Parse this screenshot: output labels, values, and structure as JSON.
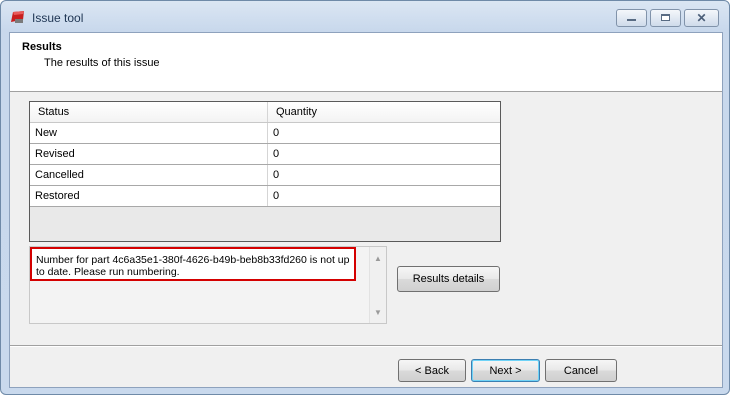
{
  "window": {
    "title": "Issue tool",
    "controls": {
      "minimize": "minimize",
      "maximize": "maximize",
      "close": "✕"
    }
  },
  "header": {
    "title": "Results",
    "subtitle": "The results of this issue"
  },
  "table": {
    "columns": [
      "Status",
      "Quantity"
    ],
    "rows": [
      {
        "status": "New",
        "quantity": "0"
      },
      {
        "status": "Revised",
        "quantity": "0"
      },
      {
        "status": "Cancelled",
        "quantity": "0"
      },
      {
        "status": "Restored",
        "quantity": "0"
      }
    ]
  },
  "message": {
    "text": "Number for part 4c6a35e1-380f-4626-b49b-beb8b33fd260 is not up to date. Please run numbering.",
    "highlight_color": "#d40000"
  },
  "buttons": {
    "results_details": "Results details",
    "back": "< Back",
    "next": "Next >",
    "cancel": "Cancel"
  }
}
